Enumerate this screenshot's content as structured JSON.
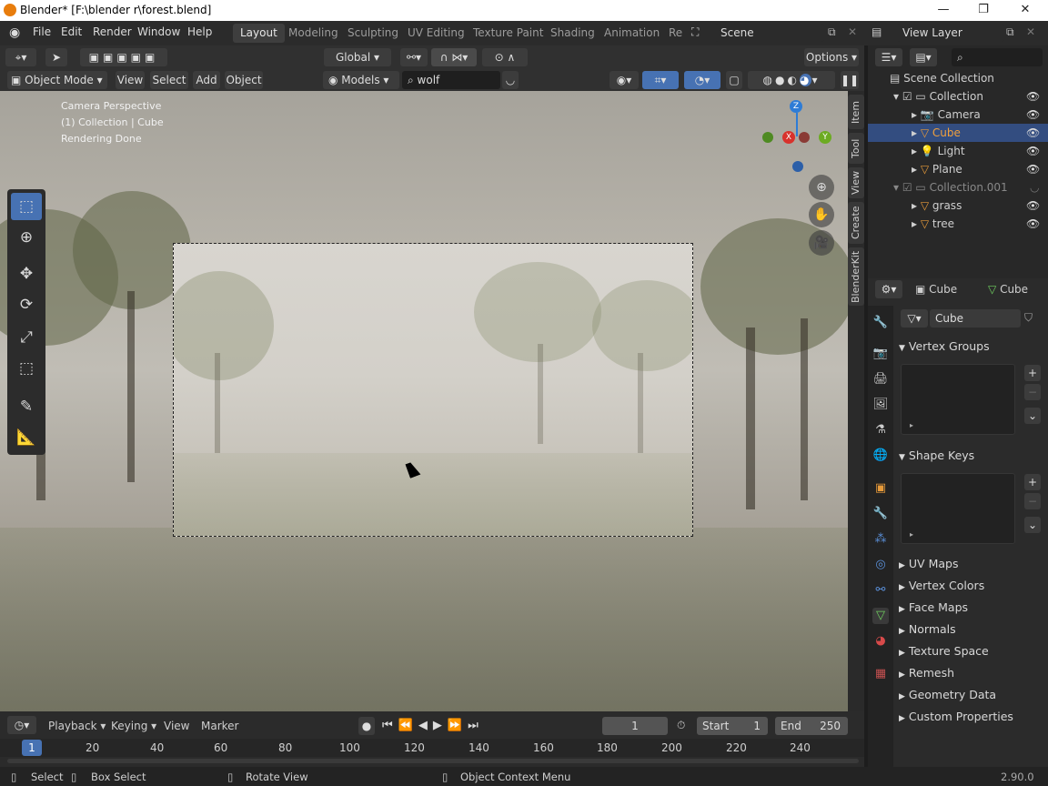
{
  "window": {
    "title": "Blender* [F:\\blender r\\forest.blend]",
    "minimize": "—",
    "maximize": "❐",
    "close": "✕"
  },
  "menu": [
    "File",
    "Edit",
    "Render",
    "Window",
    "Help"
  ],
  "workspaces": [
    "Layout",
    "Modeling",
    "Sculpting",
    "UV Editing",
    "Texture Paint",
    "Shading",
    "Animation",
    "Re"
  ],
  "scene": "Scene",
  "view_layer": "View Layer",
  "viewport_header": {
    "transform": "Global",
    "options": "Options",
    "mode": "Object Mode",
    "menus": [
      "View",
      "Select",
      "Add",
      "Object"
    ],
    "models": "Models",
    "search": "wolf"
  },
  "overlay_text": [
    "Camera Perspective",
    "(1) Collection | Cube",
    "Rendering Done"
  ],
  "gizmo": {
    "z": "Z",
    "x": "X",
    "y": "Y"
  },
  "side_tabs": [
    "Item",
    "Tool",
    "View",
    "Create",
    "BlenderKit"
  ],
  "outliner": {
    "root": "Scene Collection",
    "items": [
      {
        "label": "Collection",
        "indent": 1
      },
      {
        "label": "Camera",
        "indent": 2
      },
      {
        "label": "Cube",
        "indent": 2,
        "selected": true
      },
      {
        "label": "Light",
        "indent": 2
      },
      {
        "label": "Plane",
        "indent": 2
      },
      {
        "label": "Collection.001",
        "indent": 1,
        "muted": true
      },
      {
        "label": "grass",
        "indent": 2
      },
      {
        "label": "tree",
        "indent": 2
      }
    ]
  },
  "properties": {
    "object": "Cube",
    "mesh": "Cube",
    "data_name": "Cube",
    "open_panels": [
      "Vertex Groups",
      "Shape Keys"
    ],
    "closed_panels": [
      "UV Maps",
      "Vertex Colors",
      "Face Maps",
      "Normals",
      "Texture Space",
      "Remesh",
      "Geometry Data",
      "Custom Properties"
    ]
  },
  "timeline": {
    "menus": [
      "Playback",
      "Keying",
      "View",
      "Marker"
    ],
    "current_frame": "1",
    "start_label": "Start",
    "start": "1",
    "end_label": "End",
    "end": "250",
    "cursor": "1",
    "ticks": [
      "20",
      "40",
      "60",
      "80",
      "100",
      "120",
      "140",
      "160",
      "180",
      "200",
      "220",
      "240"
    ]
  },
  "status": {
    "select": "Select",
    "box_select": "Box Select",
    "rotate": "Rotate View",
    "context": "Object Context Menu",
    "version": "2.90.0"
  },
  "colors": {
    "accent": "#4772b3",
    "selection": "#334d80",
    "active_object": "#f1a03d"
  }
}
